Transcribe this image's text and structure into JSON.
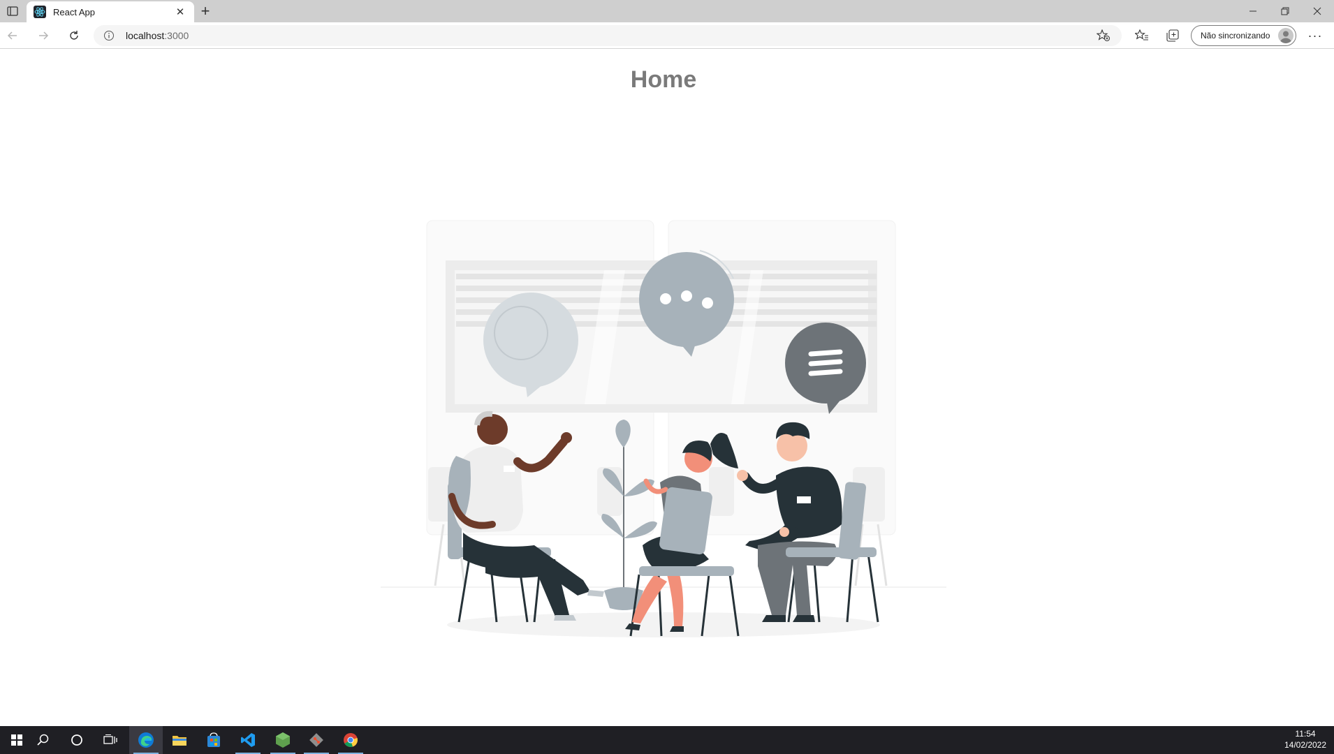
{
  "browser": {
    "tab": {
      "title": "React App"
    },
    "address": {
      "host": "localhost",
      "port": ":3000"
    },
    "sync_label": "Não sincronizando"
  },
  "page": {
    "heading": "Home"
  },
  "taskbar": {
    "apps": [
      "start-icon",
      "search-icon",
      "cortana-icon",
      "task-view-icon",
      "edge-icon",
      "file-explorer-icon",
      "store-icon",
      "vscode-icon",
      "nodejs-icon",
      "git-icon",
      "chrome-icon"
    ],
    "time": "11:54",
    "date": "14/02/2022"
  },
  "colors": {
    "heading": "#7a7a7a",
    "illustration_light": "#c9d1d7",
    "illustration_mid": "#a7b2ba",
    "illustration_dark": "#263238",
    "accent_skin": "#f28f79"
  }
}
